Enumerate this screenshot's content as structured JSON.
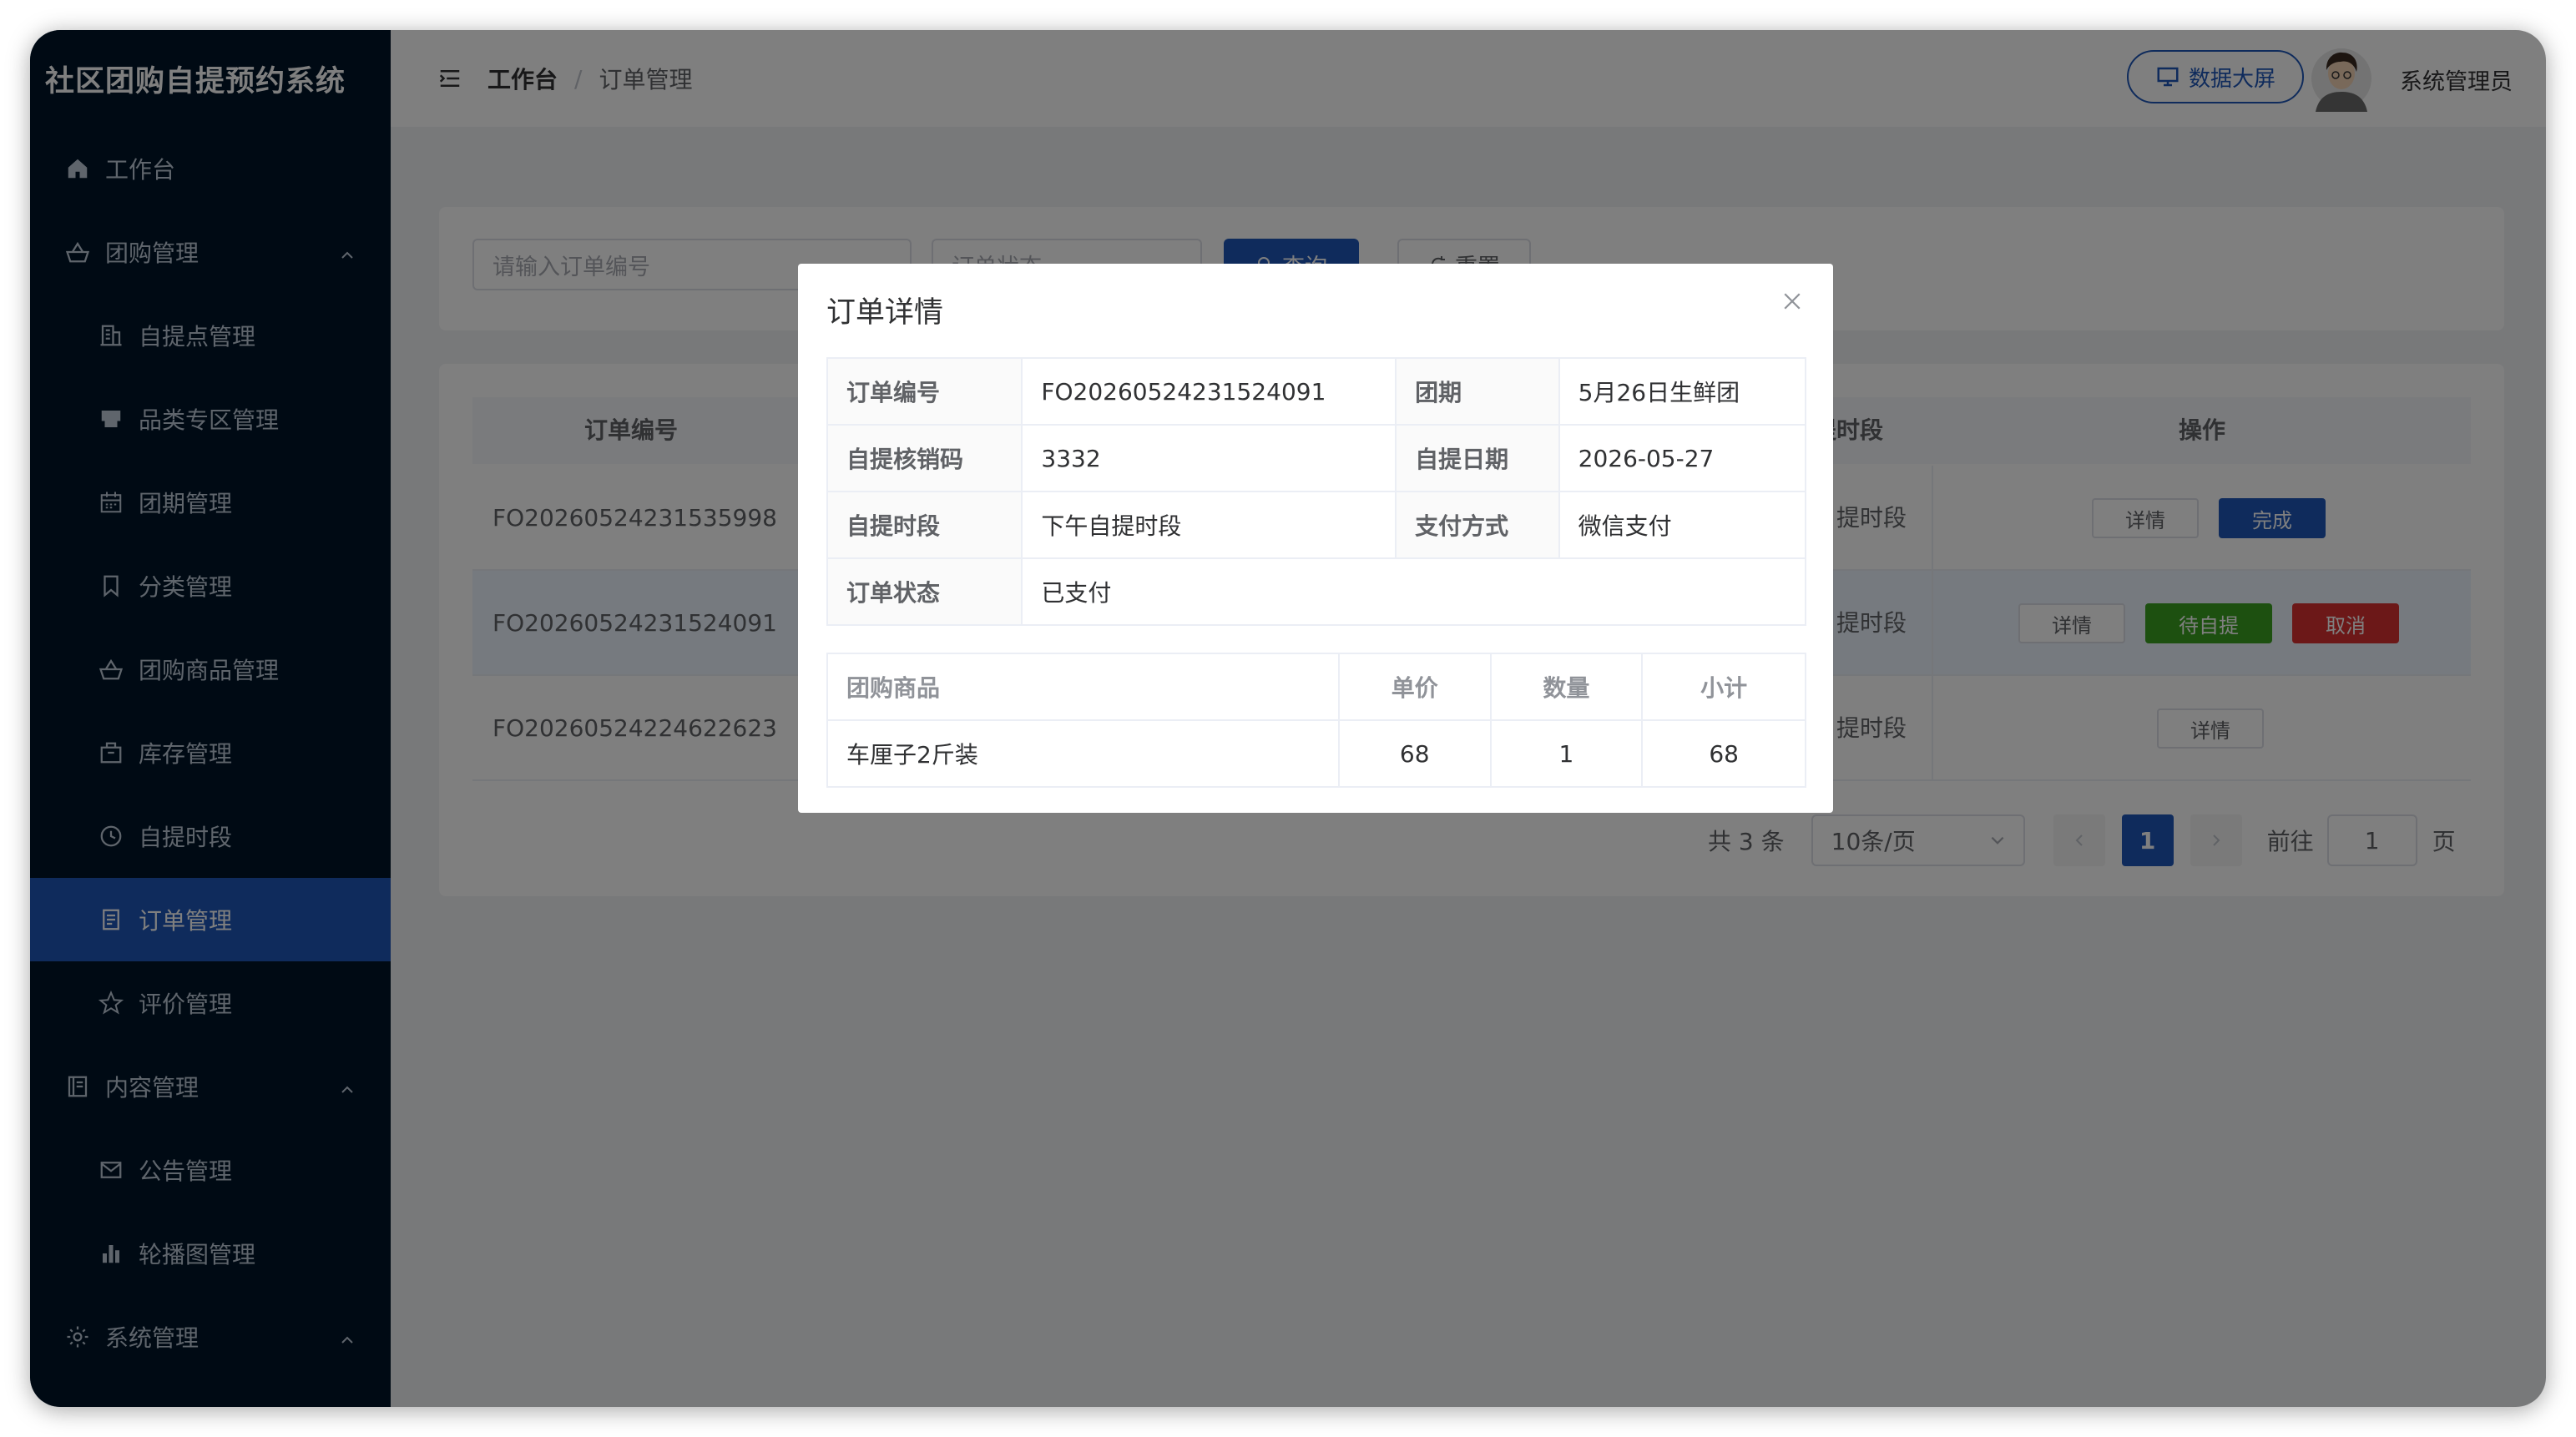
{
  "app": {
    "title": "社区团购自提预约系统"
  },
  "sidebar": {
    "items": [
      {
        "label": "工作台",
        "icon": "home-icon"
      },
      {
        "label": "团购管理",
        "icon": "basket-icon"
      },
      {
        "label": "自提点管理",
        "icon": "building-icon"
      },
      {
        "label": "品类专区管理",
        "icon": "shop-icon"
      },
      {
        "label": "团期管理",
        "icon": "calendar-icon"
      },
      {
        "label": "分类管理",
        "icon": "bookmark-icon"
      },
      {
        "label": "团购商品管理",
        "icon": "basket-icon"
      },
      {
        "label": "库存管理",
        "icon": "box-icon"
      },
      {
        "label": "自提时段",
        "icon": "clock-icon"
      },
      {
        "label": "订单管理",
        "icon": "document-icon"
      },
      {
        "label": "评价管理",
        "icon": "star-icon"
      },
      {
        "label": "内容管理",
        "icon": "notebook-icon"
      },
      {
        "label": "公告管理",
        "icon": "mail-icon"
      },
      {
        "label": "轮播图管理",
        "icon": "bar-chart-icon"
      },
      {
        "label": "系统管理",
        "icon": "gear-icon"
      }
    ]
  },
  "header": {
    "breadcrumb": [
      "工作台",
      "订单管理"
    ],
    "breadcrumb_sep": "/",
    "screen_button": "数据大屏",
    "user_name": "系统管理员"
  },
  "search": {
    "order_no_placeholder": "请输入订单编号",
    "status_placeholder": "订单状态",
    "query_label": "查询",
    "reset_label": "重置"
  },
  "table": {
    "headers": {
      "order_no": "订单编号",
      "slot": "自提时段",
      "ops": "操作"
    },
    "rows": [
      {
        "order_no": "FO20260524231535998",
        "slot": "下午自提时段"
      },
      {
        "order_no": "FO20260524231524091",
        "slot": "下午自提时段"
      },
      {
        "order_no": "FO20260524224622623",
        "slot": "下午自提时段"
      }
    ],
    "btn_detail": "详情",
    "btn_done": "完成",
    "btn_pending": "待自提",
    "btn_cancel": "取消"
  },
  "pagination": {
    "total": "共 3 条",
    "page_size": "10条/页",
    "current": "1",
    "goto_label": "前往",
    "goto_value": "1",
    "page_unit": "页"
  },
  "dialog": {
    "title": "订单详情",
    "fields": {
      "order_no_label": "订单编号",
      "order_no": "FO20260524231524091",
      "period_label": "团期",
      "period": "5月26日生鲜团",
      "code_label": "自提核销码",
      "code": "3332",
      "date_label": "自提日期",
      "date": "2026-05-27",
      "slot_label": "自提时段",
      "slot": "下午自提时段",
      "pay_label": "支付方式",
      "pay": "微信支付",
      "status_label": "订单状态",
      "status": "已支付"
    },
    "goods": {
      "headers": [
        "团购商品",
        "单价",
        "数量",
        "小计"
      ],
      "rows": [
        [
          "车厘子2斤装",
          "68",
          "1",
          "68"
        ]
      ]
    }
  },
  "colors": {
    "primary": "#1f57b8",
    "sidebar_bg": "#001529",
    "success": "#3aa020",
    "danger": "#d93030"
  }
}
